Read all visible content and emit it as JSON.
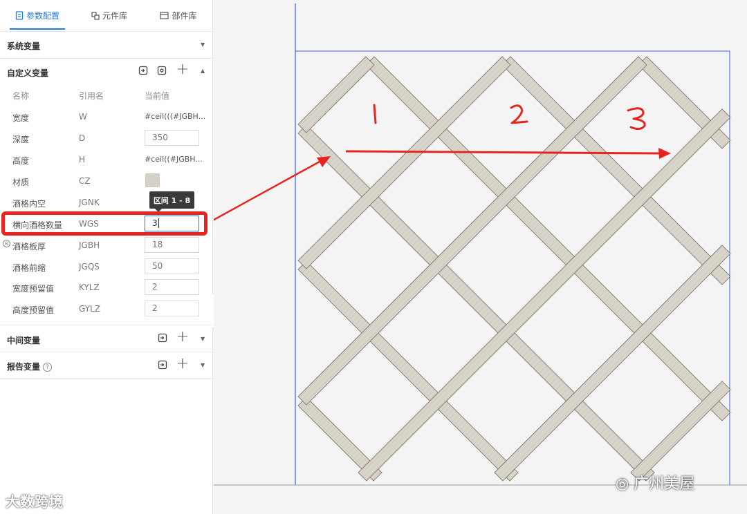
{
  "tabs": [
    {
      "label": "参数配置",
      "active": true
    },
    {
      "label": "元件库",
      "active": false
    },
    {
      "label": "部件库",
      "active": false
    }
  ],
  "sections": {
    "system": "系统变量",
    "custom": "自定义变量",
    "middle": "中间变量",
    "report": "报告变量"
  },
  "columns": {
    "name": "名称",
    "ref": "引用名",
    "value": "当前值"
  },
  "variables": [
    {
      "name": "宽度",
      "ref": "W",
      "value": "#ceil(((#JGBH..."
    },
    {
      "name": "深度",
      "ref": "D",
      "value": "350"
    },
    {
      "name": "高度",
      "ref": "H",
      "value": "#ceil((#JGBH..."
    },
    {
      "name": "材质",
      "ref": "CZ",
      "value": ""
    },
    {
      "name": "酒格内空",
      "ref": "JGNK",
      "value": ""
    },
    {
      "name": "横向酒格数量",
      "ref": "WGS",
      "value": "3"
    },
    {
      "name": "酒格板厚",
      "ref": "JGBH",
      "value": "18"
    },
    {
      "name": "酒格前缩",
      "ref": "JGQS",
      "value": "50"
    },
    {
      "name": "宽度预留值",
      "ref": "KYLZ",
      "value": "2"
    },
    {
      "name": "高度预留值",
      "ref": "GYLZ",
      "value": "2"
    }
  ],
  "tooltip": "区间 1 - 8",
  "annotations": {
    "n1": "1",
    "n2": "2",
    "n3": "3"
  },
  "watermarks": {
    "left": "大数跨境",
    "right": "广州美屋"
  },
  "colors": {
    "accent": "#1e7ae0",
    "highlight": "#e82420",
    "wood": "#d9d4ca",
    "frame": "#3b5bdb"
  }
}
